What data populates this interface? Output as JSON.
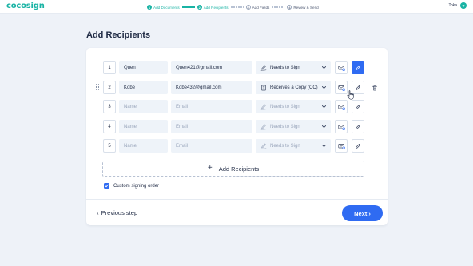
{
  "app": {
    "logo": "cocosign"
  },
  "steps": [
    {
      "num": "1",
      "label": "Add Documents",
      "status": "done"
    },
    {
      "num": "2",
      "label": "Add Recipients",
      "status": "done"
    },
    {
      "num": "3",
      "label": "Add Fields",
      "status": "pending"
    },
    {
      "num": "4",
      "label": "Review & Send",
      "status": "pending"
    }
  ],
  "user": {
    "name": "Toka",
    "avatar_initial": "T"
  },
  "page": {
    "title": "Add Recipients"
  },
  "recipients": [
    {
      "index": "1",
      "name": "Quen",
      "email": "Quen421@gmail.com",
      "role": "Needs to Sign",
      "role_icon": "pen-icon",
      "edit_active": true,
      "show_trash": false,
      "show_drag": false,
      "empty": false
    },
    {
      "index": "2",
      "name": "Kobe",
      "email": "Kobe432@gmail.com",
      "role": "Receives a Copy (CC)",
      "role_icon": "copy-icon",
      "edit_active": false,
      "show_trash": true,
      "show_drag": true,
      "empty": false
    },
    {
      "index": "3",
      "name": "",
      "email": "",
      "role": "Needs to Sign",
      "role_icon": "pen-icon",
      "edit_active": false,
      "show_trash": false,
      "show_drag": false,
      "empty": true
    },
    {
      "index": "4",
      "name": "",
      "email": "",
      "role": "Needs to Sign",
      "role_icon": "pen-icon",
      "edit_active": false,
      "show_trash": false,
      "show_drag": false,
      "empty": true
    },
    {
      "index": "5",
      "name": "",
      "email": "",
      "role": "Needs to Sign",
      "role_icon": "pen-icon",
      "edit_active": false,
      "show_trash": false,
      "show_drag": false,
      "empty": true
    }
  ],
  "placeholders": {
    "name": "Name",
    "email": "Email"
  },
  "add_recipients": {
    "label": "Add Recipients",
    "icon": "plus-icon"
  },
  "custom_order": {
    "label": "Custom signing order",
    "checked": true
  },
  "footer": {
    "prev_label": "Previous step",
    "next_label": "Next"
  },
  "colors": {
    "brand": "#19b3a4",
    "primary": "#2f6bf2",
    "text": "#1f2a44",
    "field_bg": "#eef3f9"
  }
}
